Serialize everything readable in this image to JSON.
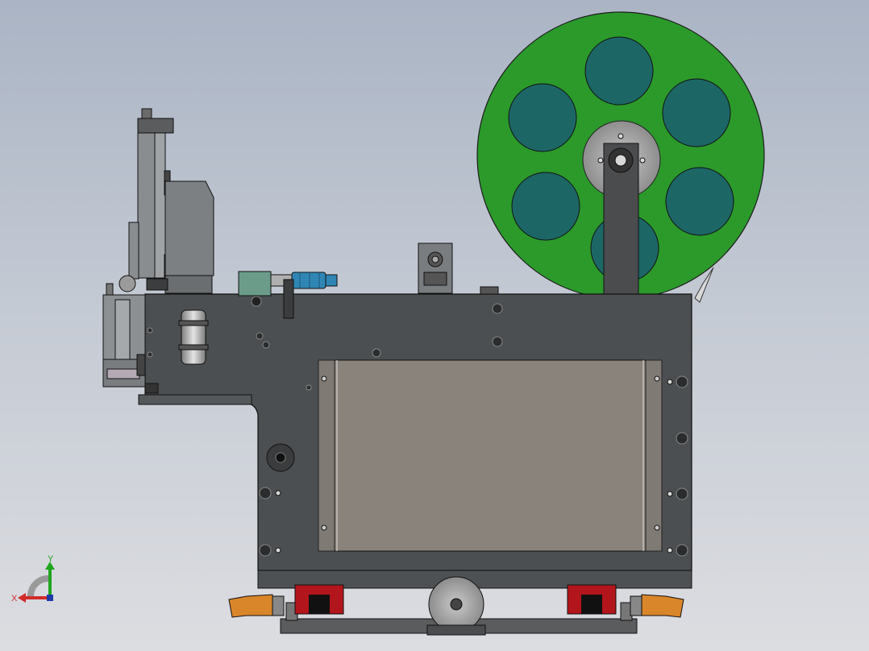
{
  "viewport": {
    "background_top": "#aab4c4",
    "background_bottom": "#dcdde1"
  },
  "triad": {
    "x_label": "X",
    "y_label": "Y",
    "x_color": "#d22a2a",
    "y_color": "#1fa61f"
  },
  "colors": {
    "plate": "#4c4f51",
    "reel": "#2b9a2b",
    "reel_holes": "#1d6666",
    "window": "#8a837c",
    "rail_block": "#b2151b",
    "bolt_handle": "#d9852a",
    "micrometer": "#2f86b5"
  }
}
